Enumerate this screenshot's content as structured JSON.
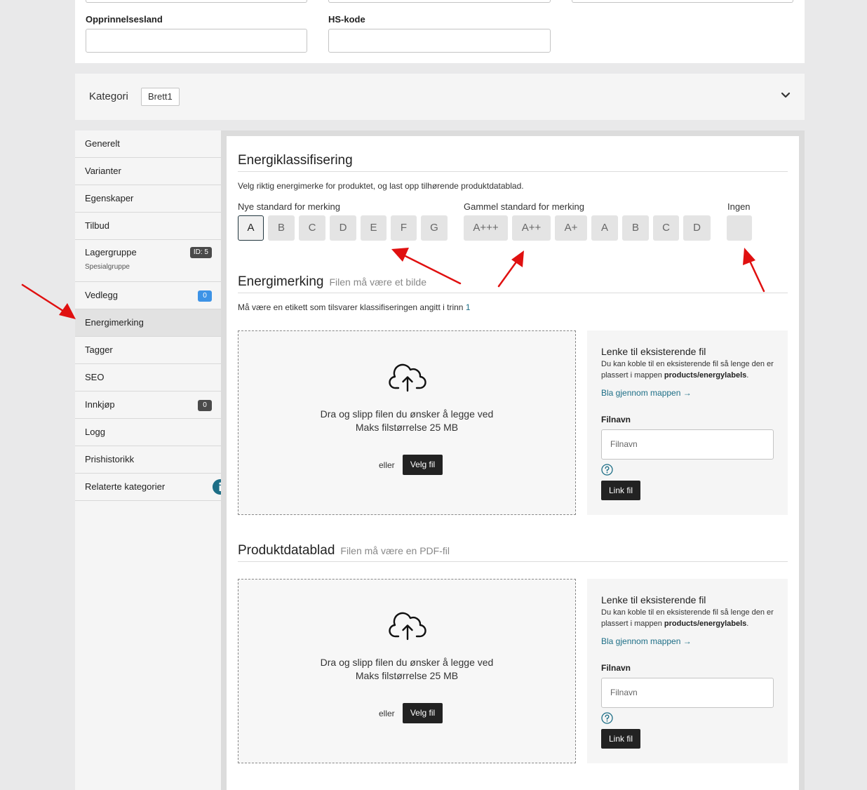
{
  "top_fields": {
    "origin_label": "Opprinnelsesland",
    "origin_value": "",
    "hs_label": "HS-kode",
    "hs_value": ""
  },
  "category_bar": {
    "label": "Kategori",
    "tag": "Brett1",
    "toggle_icon": "chevron-down-icon"
  },
  "sidebar": {
    "items": [
      {
        "label": "Generelt"
      },
      {
        "label": "Varianter"
      },
      {
        "label": "Egenskaper"
      },
      {
        "label": "Tilbud"
      },
      {
        "label": "Lagergruppe",
        "sub": "Spesialgruppe",
        "badge": "ID: 5"
      },
      {
        "label": "Vedlegg",
        "badge": "0"
      },
      {
        "label": "Energimerking",
        "active": true
      },
      {
        "label": "Tagger"
      },
      {
        "label": "SEO"
      },
      {
        "label": "Innkjøp",
        "badge": "0"
      },
      {
        "label": "Logg"
      },
      {
        "label": "Prishistorikk"
      },
      {
        "label": "Relaterte kategorier",
        "icon": "info-icon"
      }
    ]
  },
  "energy_class": {
    "title": "Energiklassifisering",
    "description": "Velg riktig energimerke for produktet, og last opp tilhørende produktdatablad.",
    "new_label": "Nye standard for merking",
    "new_options": [
      "A",
      "B",
      "C",
      "D",
      "E",
      "F",
      "G"
    ],
    "selected": "A",
    "old_label": "Gammel standard for merking",
    "old_options": [
      "A+++",
      "A++",
      "A+",
      "A",
      "B",
      "C",
      "D"
    ],
    "none_label": "Ingen"
  },
  "energy_label": {
    "title": "Energimerking",
    "subtitle": "Filen må være et bilde",
    "note": "Må være en etikett som tilsvarer klassifiseringen angitt i trinn",
    "note_step": "1"
  },
  "datasheet": {
    "title": "Produktdatablad",
    "subtitle": "Filen må være en PDF-fil"
  },
  "dropzone": {
    "icon": "cloud-upload-icon",
    "line1": "Dra og slipp filen du ønsker å legge ved",
    "line2": "Maks filstørrelse 25 MB",
    "or": "eller",
    "button": "Velg fil"
  },
  "link_existing": {
    "title": "Lenke til eksisterende fil",
    "desc": "Du kan koble til en eksisterende fil så lenge den er plassert i mappen",
    "folder": "products/energylabels",
    "browse": "Bla gjennom mappen →",
    "filename_label": "Filnavn",
    "filename_placeholder": "Filnavn",
    "help_icon": "question-circle-icon",
    "button": "Link fil"
  },
  "colors": {
    "accent": "#1d6e86",
    "dark_button": "#222222",
    "blue_badge": "#3d93e6",
    "annotation_arrow": "#e01010"
  }
}
